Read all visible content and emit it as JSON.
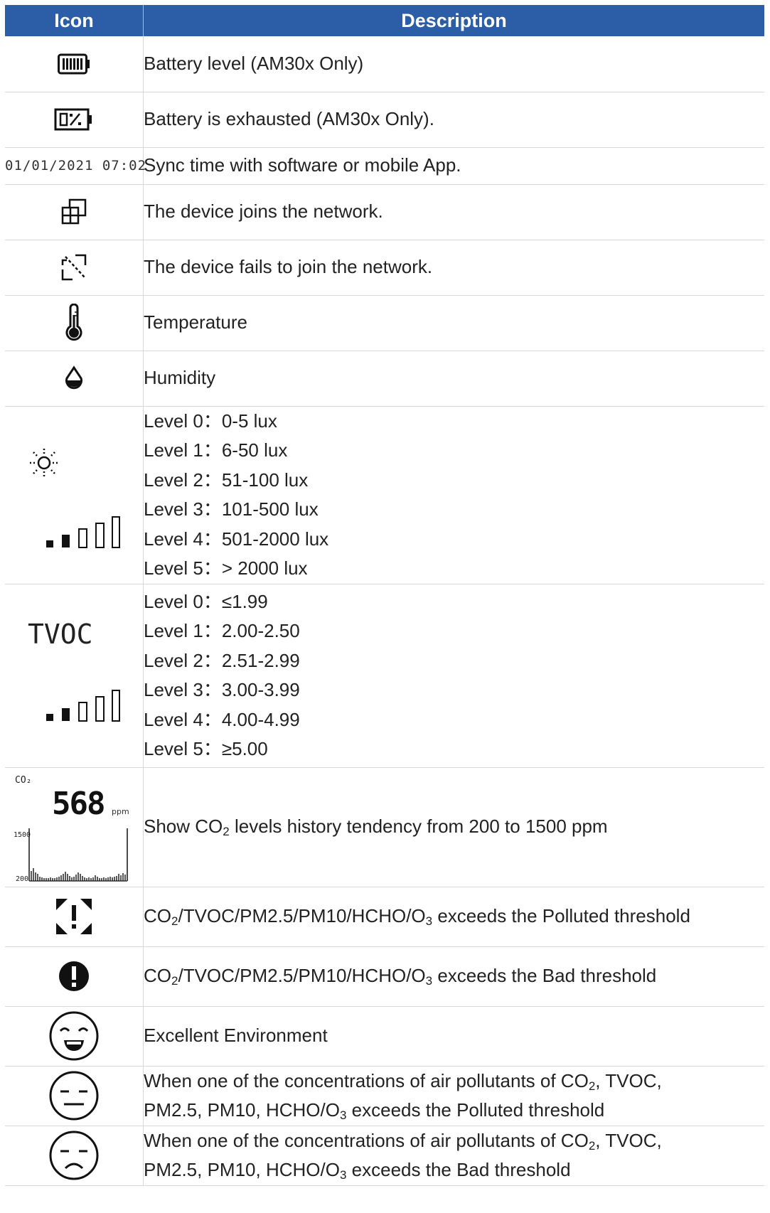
{
  "table": {
    "headers": {
      "icon": "Icon",
      "description": "Description"
    },
    "rows": {
      "battery": {
        "icon": "battery-full-icon",
        "text": "Battery level (AM30x Only)"
      },
      "battery_empty": {
        "icon": "battery-empty-icon",
        "text": "Battery is exhausted (AM30x Only)."
      },
      "sync": {
        "icon_text": "01/01/2021  07:02",
        "text": "Sync time with software or mobile App."
      },
      "join": {
        "icon": "network-join-icon",
        "text": "The device joins the network."
      },
      "fail": {
        "icon": "network-fail-icon",
        "text": "The device fails to join the network."
      },
      "temp": {
        "icon": "thermometer-icon",
        "text": "Temperature"
      },
      "humid": {
        "icon": "droplet-icon",
        "text": "Humidity"
      },
      "light": {
        "icon": "sun-icon",
        "levels": [
          {
            "label": "Level 0：",
            "value": "0-5 lux"
          },
          {
            "label": "Level 1：",
            "value": "6-50 lux"
          },
          {
            "label": "Level 2：",
            "value": "51-100 lux"
          },
          {
            "label": "Level 3：",
            "value": "101-500 lux"
          },
          {
            "label": "Level 4：",
            "value": "501-2000 lux"
          },
          {
            "label": "Level 5：",
            "value": "> 2000 lux"
          }
        ]
      },
      "tvoc": {
        "icon_text": "TVOC",
        "levels": [
          {
            "label": "Level 0：",
            "value": "≤1.99"
          },
          {
            "label": "Level 1：",
            "value": "2.00-2.50"
          },
          {
            "label": "Level 2：",
            "value": "2.51-2.99"
          },
          {
            "label": "Level 3：",
            "value": "3.00-3.99"
          },
          {
            "label": "Level 4：",
            "value": "4.00-4.99"
          },
          {
            "label": "Level 5：",
            "value": "≥5.00"
          }
        ]
      },
      "co2": {
        "icon_label": "CO₂",
        "icon_value": "568",
        "icon_unit": "ppm",
        "icon_ymax": "1500",
        "icon_ymin": "200",
        "text_a": "Show CO",
        "text_sub": "2",
        "text_b": " levels history tendency from 200 to 1500 ppm"
      },
      "polluted": {
        "icon": "polluted-warning-icon",
        "t1": "CO",
        "s1": "2",
        "t2": "/TVOC/PM2.5/PM10/HCHO/O",
        "s2": "3",
        "t3": " exceeds the Polluted threshold"
      },
      "bad": {
        "icon": "bad-alert-icon",
        "t1": "CO",
        "s1": "2",
        "t2": "/TVOC/PM2.5/PM10/HCHO/O",
        "s2": "3",
        "t3": " exceeds the Bad threshold"
      },
      "excellent": {
        "icon": "smiling-face-icon",
        "text": "Excellent Environment"
      },
      "face_polluted": {
        "icon": "neutral-face-icon",
        "l1a": "When one of the concentrations of air pollutants of CO",
        "l1s": "2",
        "l1b": ", TVOC,",
        "l2a": "PM2.5, PM10, HCHO/O",
        "l2s": "3",
        "l2b": " exceeds the Polluted threshold"
      },
      "face_bad": {
        "icon": "sad-face-icon",
        "l1a": "When one of the concentrations of air pollutants of CO",
        "l1s": "2",
        "l1b": ", TVOC,",
        "l2a": "PM2.5, PM10, HCHO/O",
        "l2s": "3",
        "l2b": " exceeds the Bad threshold"
      }
    }
  }
}
